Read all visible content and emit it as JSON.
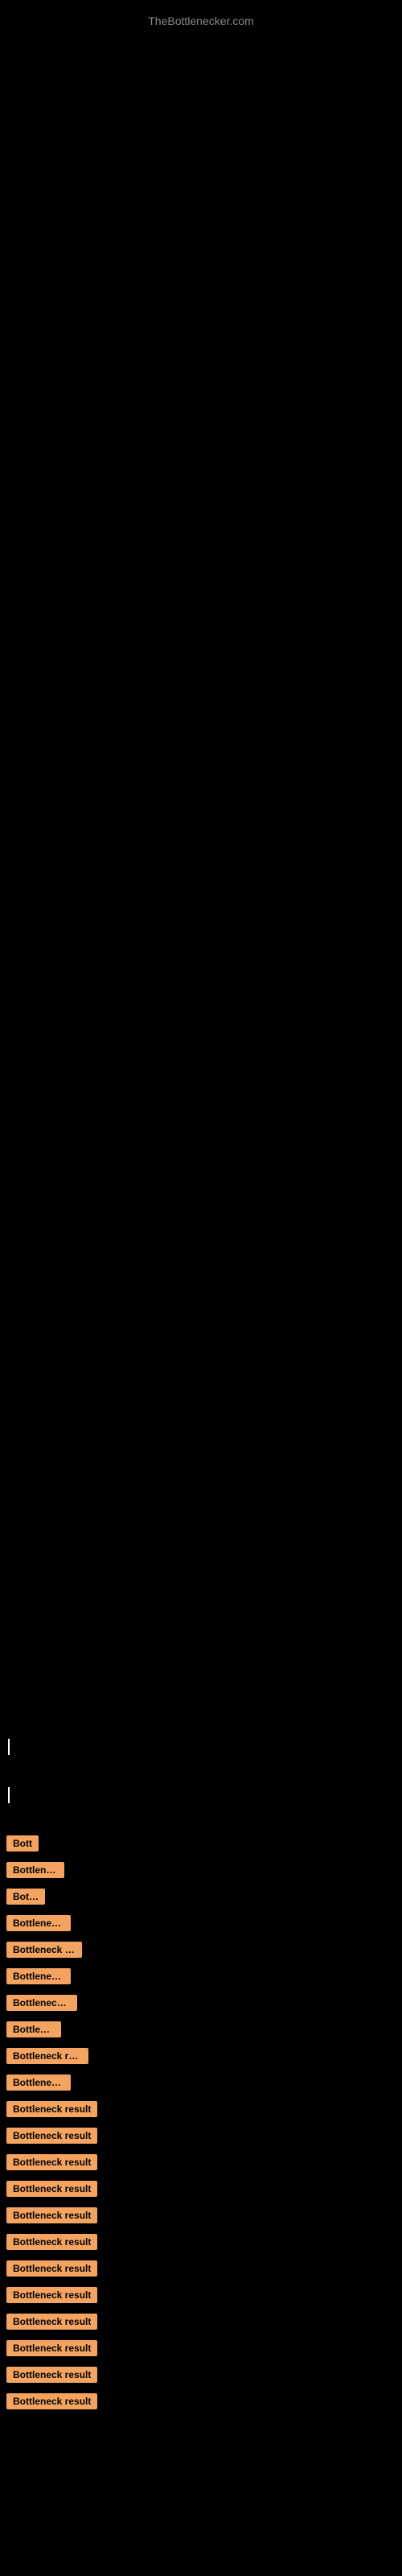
{
  "site": {
    "title": "TheBottlenecker.com"
  },
  "results": [
    {
      "id": 1,
      "label": "Bott",
      "width": 42
    },
    {
      "id": 2,
      "label": "Bottleneck",
      "width": 72
    },
    {
      "id": 3,
      "label": "Bottle",
      "width": 48
    },
    {
      "id": 4,
      "label": "Bottleneck r",
      "width": 80
    },
    {
      "id": 5,
      "label": "Bottleneck res",
      "width": 94
    },
    {
      "id": 6,
      "label": "Bottleneck r",
      "width": 80
    },
    {
      "id": 7,
      "label": "Bottleneck re",
      "width": 88
    },
    {
      "id": 8,
      "label": "Bottlenec",
      "width": 68
    },
    {
      "id": 9,
      "label": "Bottleneck resu",
      "width": 102
    },
    {
      "id": 10,
      "label": "Bottleneck r",
      "width": 80
    },
    {
      "id": 11,
      "label": "Bottleneck result",
      "width": 118
    },
    {
      "id": 12,
      "label": "Bottleneck result",
      "width": 118
    },
    {
      "id": 13,
      "label": "Bottleneck result",
      "width": 118
    },
    {
      "id": 14,
      "label": "Bottleneck result",
      "width": 118
    },
    {
      "id": 15,
      "label": "Bottleneck result",
      "width": 118
    },
    {
      "id": 16,
      "label": "Bottleneck result",
      "width": 118
    },
    {
      "id": 17,
      "label": "Bottleneck result",
      "width": 118
    },
    {
      "id": 18,
      "label": "Bottleneck result",
      "width": 118
    },
    {
      "id": 19,
      "label": "Bottleneck result",
      "width": 118
    },
    {
      "id": 20,
      "label": "Bottleneck result",
      "width": 118
    },
    {
      "id": 21,
      "label": "Bottleneck result",
      "width": 118
    },
    {
      "id": 22,
      "label": "Bottleneck result",
      "width": 118
    }
  ],
  "colors": {
    "background": "#000000",
    "badge": "#f4a460",
    "site_title": "#888888",
    "text": "#ffffff"
  }
}
